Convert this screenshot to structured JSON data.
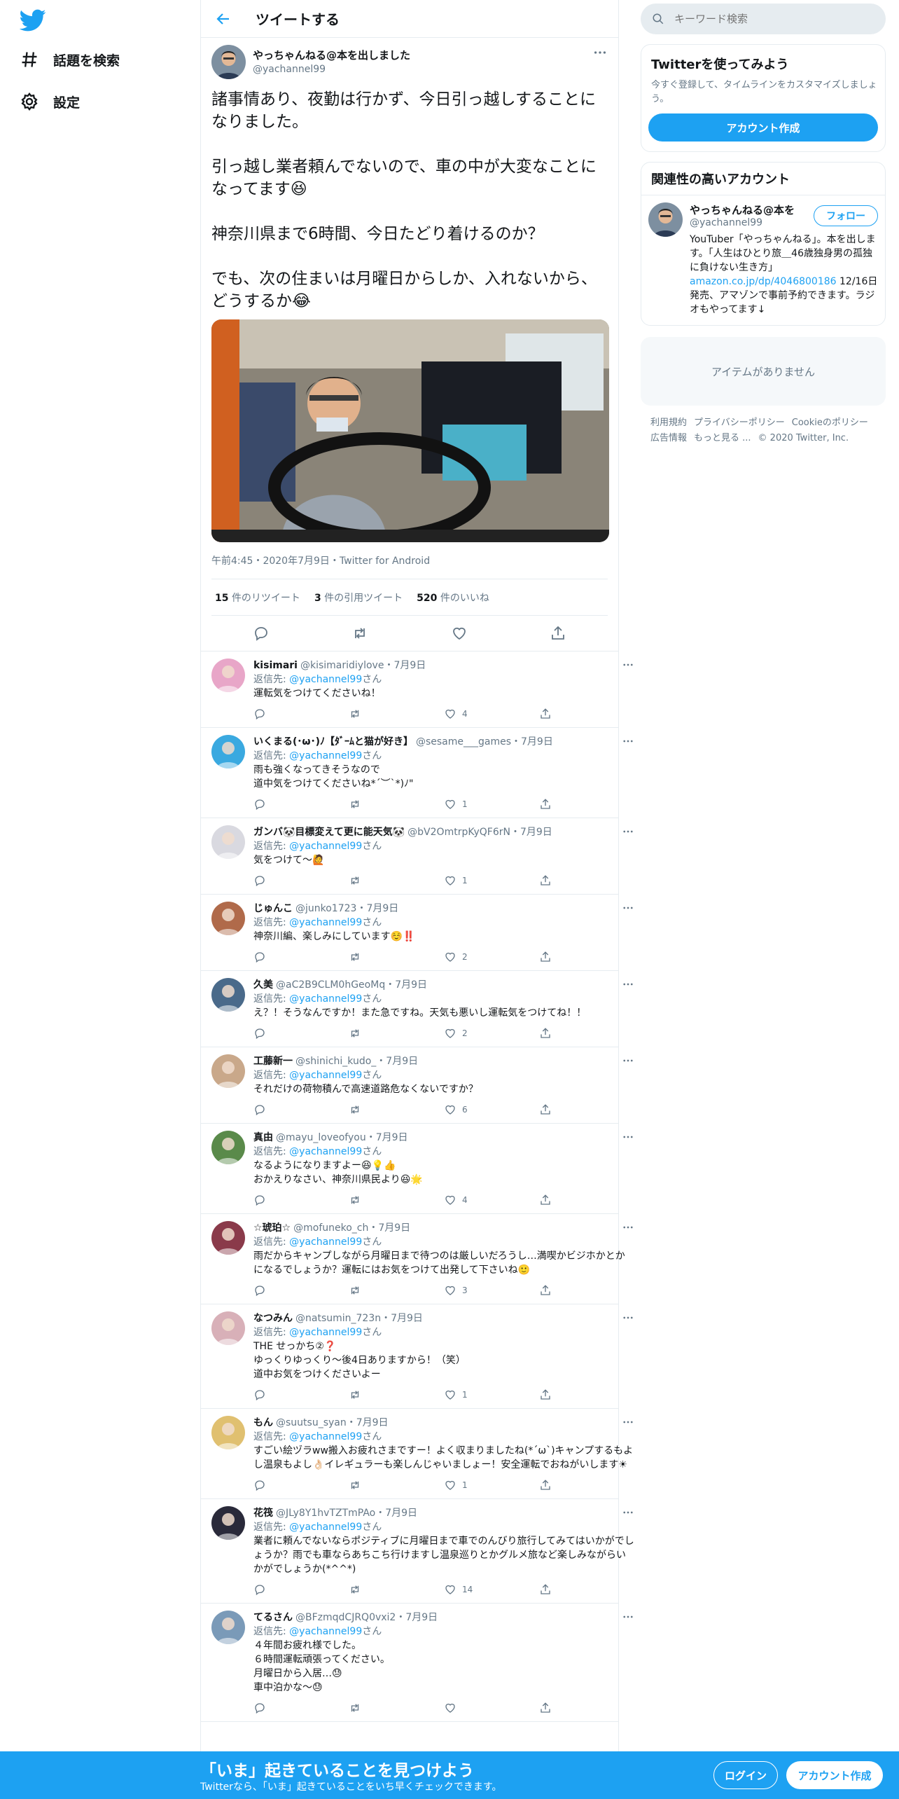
{
  "nav": {
    "logo_icon": "twitter-bird-icon",
    "items": [
      {
        "label": "話題を検索",
        "icon": "hashtag-icon"
      },
      {
        "label": "設定",
        "icon": "gear-icon"
      }
    ]
  },
  "header": {
    "title": "ツイートする",
    "back_icon": "arrow-left-icon"
  },
  "main_tweet": {
    "author_name": "やっちゃんねる@本を出しました",
    "author_handle": "@yachannel99",
    "text": "諸事情あり、夜勤は行かず、今日引っ越しすることになりました。\n\n引っ越し業者頼んでないので、車の中が大変なことになってます😆\n\n神奈川県まで6時間、今日たどり着けるのか？\n\nでも、次の住まいは月曜日からしか、入れないから、どうするか😂",
    "timestamp": "午前4:45・2020年7月9日・Twitter for Android",
    "stats": {
      "retweets_count": "15",
      "retweets_label": "件のリツイート",
      "quotes_count": "3",
      "quotes_label": "件の引用ツイート",
      "likes_count": "520",
      "likes_label": "件のいいね"
    }
  },
  "replies": [
    {
      "name": "kisimari",
      "meta": "@kisimaridiylove・7月9日",
      "reply_prefix": "返信先: ",
      "reply_to": "@yachannel99",
      "reply_suffix": "さん",
      "text": "運転気をつけてくださいね！",
      "likes": "4",
      "avatar_color": "#e8a6c8"
    },
    {
      "name": "いくまる(･ω･)ﾉ【ﾀﾞｰﾑと猫が好き】",
      "meta": "@sesame___games・7月9日",
      "reply_prefix": "返信先: ",
      "reply_to": "@yachannel99",
      "reply_suffix": "さん",
      "text": "雨も強くなってきそうなので\n道中気をつけてくださいね*´︶`*)ﾉ\"",
      "likes": "1",
      "avatar_color": "#3aa9e0"
    },
    {
      "name": "ガンバ🐼目標変えて更に能天気🐼",
      "meta": "@bV2OmtrpKyQF6rN・7月9日",
      "reply_prefix": "返信先: ",
      "reply_to": "@yachannel99",
      "reply_suffix": "さん",
      "text": "気をつけて～🙋",
      "likes": "1",
      "avatar_color": "#d9d9e0"
    },
    {
      "name": "じゅんこ",
      "meta": "@junko1723・7月9日",
      "reply_prefix": "返信先: ",
      "reply_to": "@yachannel99",
      "reply_suffix": "さん",
      "text": "神奈川編、楽しみにしています☺️‼️",
      "likes": "2",
      "avatar_color": "#b06a4a"
    },
    {
      "name": "久美",
      "meta": "@aC2B9CLM0hGeoMq・7月9日",
      "reply_prefix": "返信先: ",
      "reply_to": "@yachannel99",
      "reply_suffix": "さん",
      "text": "え？！そうなんですか！また急ですね。天気も悪いし運転気をつけてね！！",
      "likes": "2",
      "avatar_color": "#4a6a8a"
    },
    {
      "name": "工藤新一",
      "meta": "@shinichi_kudo_・7月9日",
      "reply_prefix": "返信先: ",
      "reply_to": "@yachannel99",
      "reply_suffix": "さん",
      "text": "それだけの荷物積んで高速道路危なくないですか？",
      "likes": "6",
      "avatar_color": "#c9a88a"
    },
    {
      "name": "真由",
      "meta": "@mayu_loveofyou・7月9日",
      "reply_prefix": "返信先: ",
      "reply_to": "@yachannel99",
      "reply_suffix": "さん",
      "text": "なるようになりますよー😆💡👍\nおかえりなさい、神奈川県民より😆🌟",
      "likes": "4",
      "avatar_color": "#5a8a4a"
    },
    {
      "name": "☆琥珀☆",
      "meta": "@mofuneko_ch・7月9日",
      "reply_prefix": "返信先: ",
      "reply_to": "@yachannel99",
      "reply_suffix": "さん",
      "text": "雨だからキャンプしながら月曜日まで待つのは厳しいだろうし…満喫かビジホかとかになるでしょうか？運転にはお気をつけて出発して下さいね🙂",
      "likes": "3",
      "avatar_color": "#8a3a4a"
    },
    {
      "name": "なつみん",
      "meta": "@natsumin_723n・7月9日",
      "reply_prefix": "返信先: ",
      "reply_to": "@yachannel99",
      "reply_suffix": "さん",
      "text": "THE せっかち②❓\nゆっくりゆっくり〜後4日ありますから！（笑）\n道中お気をつけくださいよー",
      "likes": "1",
      "avatar_color": "#d8b0b8"
    },
    {
      "name": "もん",
      "meta": "@suutsu_syan・7月9日",
      "reply_prefix": "返信先: ",
      "reply_to": "@yachannel99",
      "reply_suffix": "さん",
      "text": "すごい絵ヅラww搬入お疲れさまですー！よく収まりましたね(*´ω`)キャンプするもよし温泉もよし👌🏻イレギュラーも楽しんじゃいましょー！安全運転でおねがいします☀",
      "likes": "1",
      "avatar_color": "#e0c070"
    },
    {
      "name": "花筏",
      "meta": "@JLy8Y1hvTZTmPAo・7月9日",
      "reply_prefix": "返信先: ",
      "reply_to": "@yachannel99",
      "reply_suffix": "さん",
      "text": "業者に頼んでないならポジティブに月曜日まで車でのんびり旅行してみてはいかがでしょうか？雨でも車ならあちこち行けますし温泉巡りとかグルメ旅など楽しみながらいかがでしょうか(*^^*)",
      "likes": "14",
      "avatar_color": "#2a2a3a"
    },
    {
      "name": "てるさん",
      "meta": "@BFzmqdCJRQ0vxi2・7月9日",
      "reply_prefix": "返信先: ",
      "reply_to": "@yachannel99",
      "reply_suffix": "さん",
      "text": "４年間お疲れ様でした。\n６時間運転頑張ってください。\n月曜日から入居…😓\n車中泊かな～😓",
      "likes": "",
      "avatar_color": "#7a9ab8"
    }
  ],
  "search": {
    "placeholder": "キーワード検索"
  },
  "signup_card": {
    "title": "Twitterを使ってみよう",
    "description": "今すぐ登録して、タイムラインをカスタマイズしましょう。",
    "button": "アカウント作成"
  },
  "related": {
    "title": "関連性の高いアカウント",
    "name": "やっちゃんねる@本を出しました",
    "handle": "@yachannel99",
    "follow": "フォロー",
    "bio_1": "YouTuber「やっちゃんねる」。本を出します。「人生はひとり旅＿46歳独身男の孤独に負けない生き方」",
    "bio_link": "amazon.co.jp/dp/4046800186",
    "bio_2": " 12/16日発売、アマゾンで事前予約できます。ラジオもやってます↓"
  },
  "no_items": "アイテムがありません",
  "footer": {
    "links": [
      "利用規約",
      "プライバシーポリシー",
      "Cookieのポリシー",
      "広告情報",
      "もっと見る ..."
    ],
    "copyright": "© 2020 Twitter, Inc."
  },
  "bottom_bar": {
    "title": "「いま」起きていることを見つけよう",
    "subtitle": "Twitterなら、「いま」起きていることをいち早くチェックできます。",
    "login": "ログイン",
    "signup": "アカウント作成"
  },
  "colors": {
    "accent": "#1da1f2",
    "text": "#14171a",
    "secondary": "#657786",
    "border": "#e6ecf0"
  }
}
